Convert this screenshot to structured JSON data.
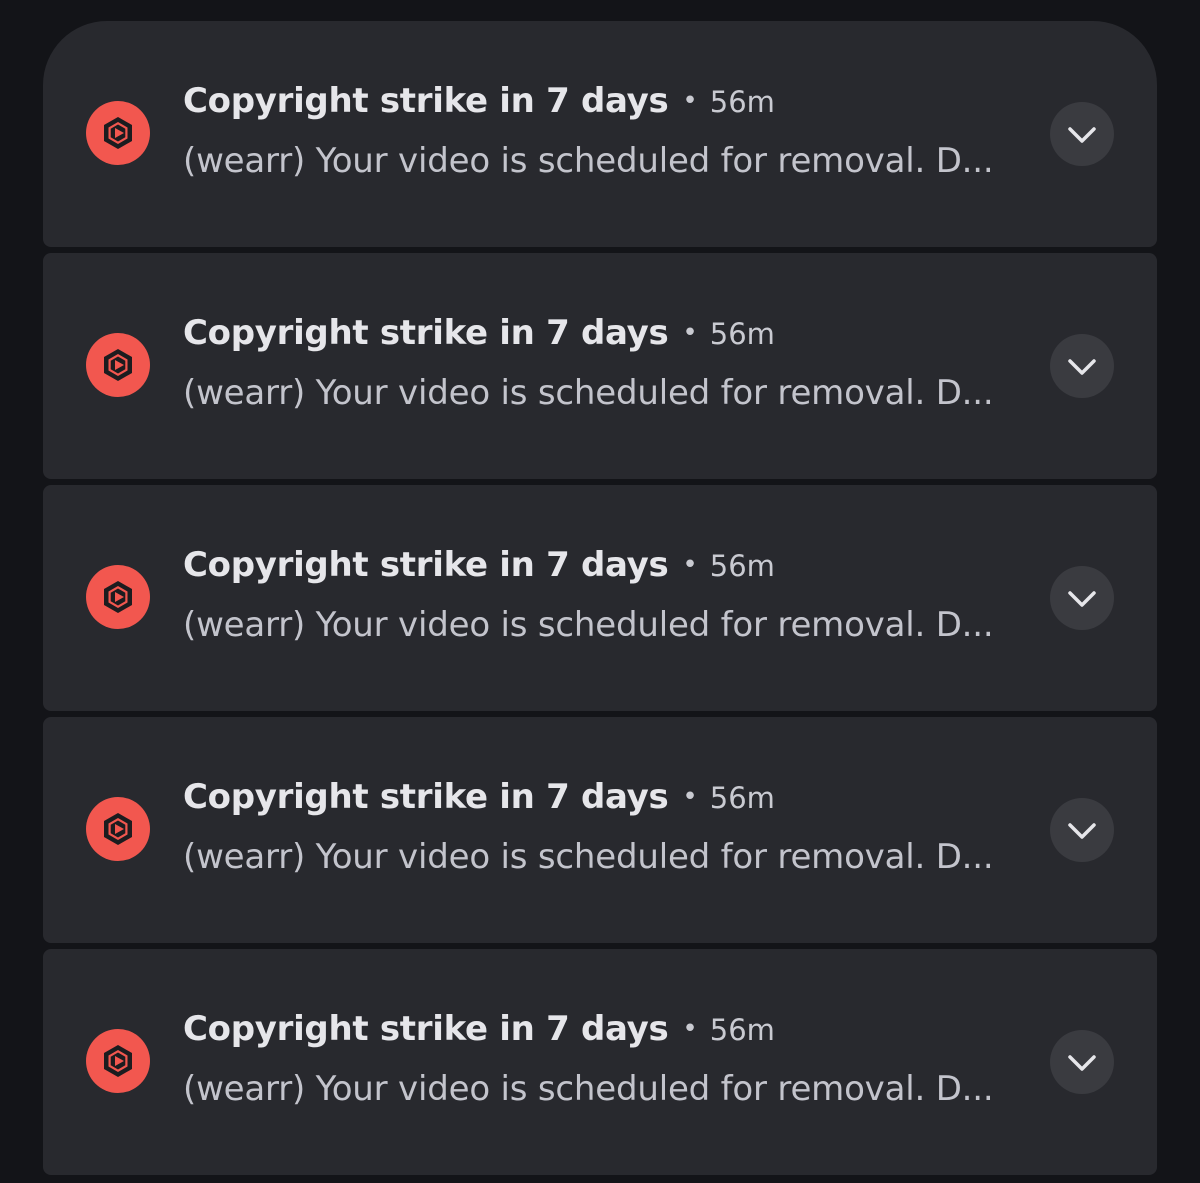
{
  "notifications": [
    {
      "title": "Copyright strike in 7 days",
      "separator": "•",
      "time": "56m",
      "body": "(wearr) Your video is scheduled for removal. D...",
      "app_icon": "youtube-studio-icon",
      "expand_icon": "chevron-down-icon"
    },
    {
      "title": "Copyright strike in 7 days",
      "separator": "•",
      "time": "56m",
      "body": "(wearr) Your video is scheduled for removal. D...",
      "app_icon": "youtube-studio-icon",
      "expand_icon": "chevron-down-icon"
    },
    {
      "title": "Copyright strike in 7 days",
      "separator": "•",
      "time": "56m",
      "body": "(wearr) Your video is scheduled for removal. D...",
      "app_icon": "youtube-studio-icon",
      "expand_icon": "chevron-down-icon"
    },
    {
      "title": "Copyright strike in 7 days",
      "separator": "•",
      "time": "56m",
      "body": "(wearr) Your video is scheduled for removal. D...",
      "app_icon": "youtube-studio-icon",
      "expand_icon": "chevron-down-icon"
    },
    {
      "title": "Copyright strike in 7 days",
      "separator": "•",
      "time": "56m",
      "body": "(wearr) Your video is scheduled for removal. D...",
      "app_icon": "youtube-studio-icon",
      "expand_icon": "chevron-down-icon"
    }
  ],
  "colors": {
    "background": "#131418",
    "card": "#28292e",
    "app_icon_bg": "#f2574f",
    "expand_button_bg": "#3a3b40",
    "title_text": "#e6e6ea",
    "body_text": "#c3c4cc"
  }
}
